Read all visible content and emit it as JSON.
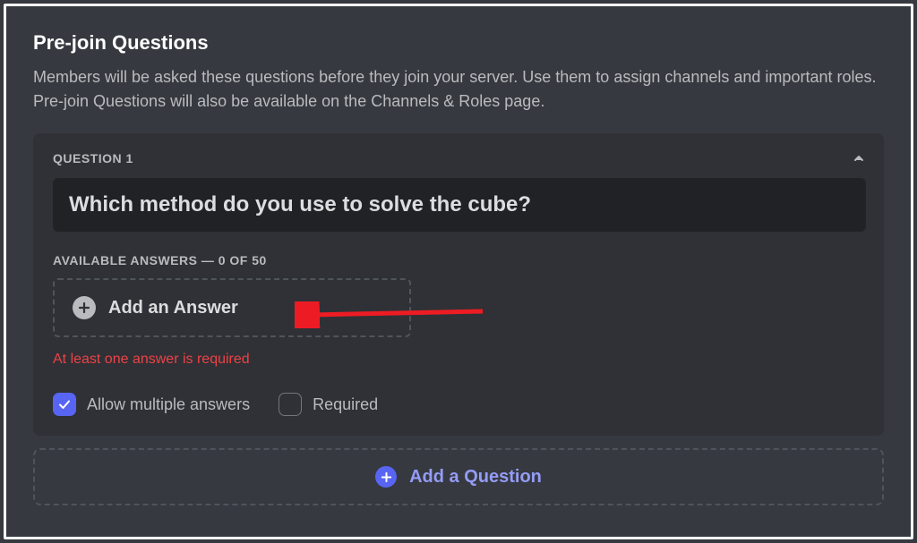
{
  "header": {
    "title": "Pre-join Questions",
    "description": "Members will be asked these questions before they join your server. Use them to assign channels and important roles. Pre-join Questions will also be available on the Channels & Roles page."
  },
  "question": {
    "number_label": "QUESTION 1",
    "text": "Which method do you use to solve the cube?",
    "available_label": "AVAILABLE ANSWERS — 0 OF 50",
    "add_answer_label": "Add an Answer",
    "error": "At least one answer is required",
    "allow_multiple_label": "Allow multiple answers",
    "required_label": "Required"
  },
  "footer": {
    "add_question_label": "Add a Question"
  }
}
